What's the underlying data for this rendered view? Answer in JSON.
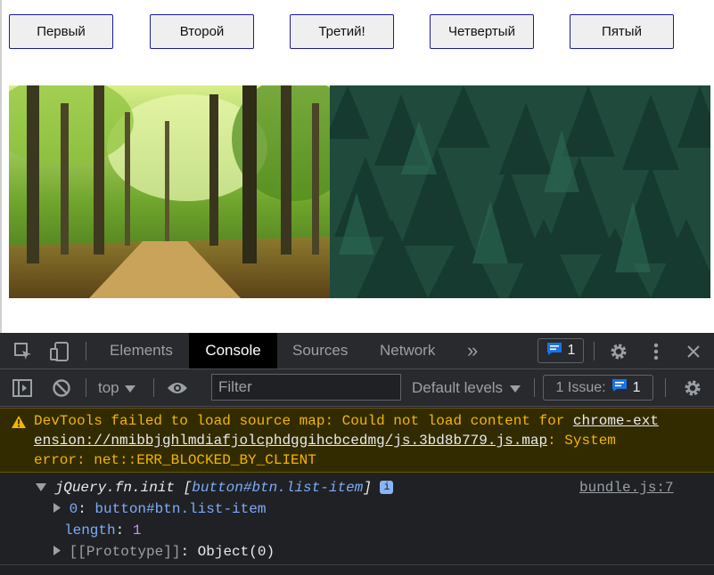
{
  "page": {
    "buttons": [
      "Первый",
      "Второй",
      "Третий!",
      "Четвертый",
      "Пятый"
    ]
  },
  "devtools": {
    "tabs": [
      "Elements",
      "Console",
      "Sources",
      "Network"
    ],
    "more_tabs_label": "»",
    "message_count": "1",
    "context": "top",
    "filter_placeholder": "Filter",
    "levels": "Default levels",
    "issues_label": "1 Issue:",
    "issues_count": "1",
    "warning": {
      "prefix": "DevTools failed to load source map: Could not load content for ",
      "link_line1": "chrome-ext",
      "link_line2": "ension://nmibbjghlmdiafjolcphdggihcbcedmg/js.3bd8b779.js.map",
      "suffix_line2": ": System",
      "line3": "error: net::ERR_BLOCKED_BY_CLIENT"
    },
    "log": {
      "head_italic": "jQuery.fn.init [",
      "head_element": "button#btn.list-item",
      "head_close": "]",
      "info_glyph": "i",
      "source": "bundle.js:7",
      "item0_key": "0",
      "item0_value": "button#btn.list-item",
      "length_key": "length",
      "length_value": "1",
      "proto_key": "[[Prototype]]",
      "proto_value": "Object(0)"
    }
  }
}
